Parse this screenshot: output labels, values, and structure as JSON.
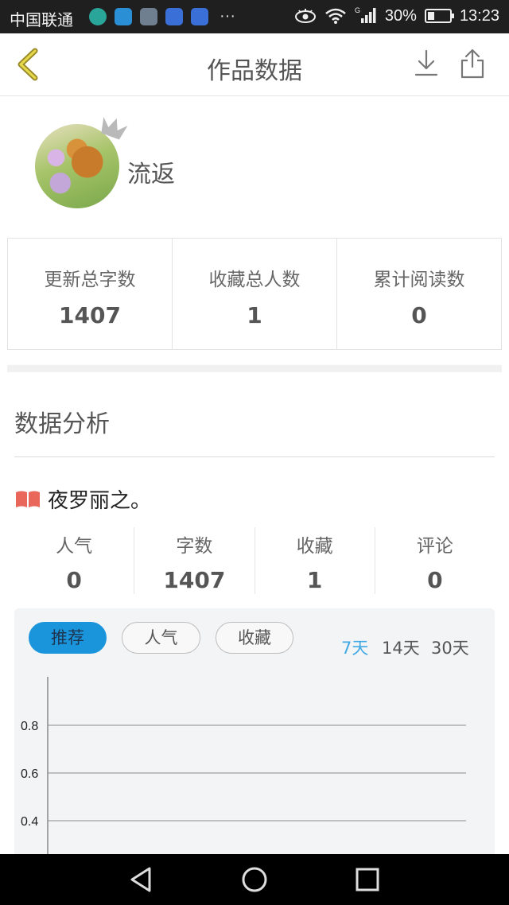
{
  "status_bar": {
    "carrier": "中国联通",
    "battery": "30%",
    "time": "13:23",
    "network_badge": "G",
    "more_indicator": "···",
    "battery_level": 0.3
  },
  "nav": {
    "title": "作品数据",
    "icons": [
      "chevron-left-icon",
      "download-icon",
      "share-icon"
    ]
  },
  "profile": {
    "username": "流返"
  },
  "stats": [
    {
      "label": "更新总字数",
      "value": "1407"
    },
    {
      "label": "收藏总人数",
      "value": "1"
    },
    {
      "label": "累计阅读数",
      "value": "0"
    }
  ],
  "analysis": {
    "title": "数据分析",
    "book_title": "夜罗丽之。",
    "metrics": [
      {
        "label": "人气",
        "value": "0"
      },
      {
        "label": "字数",
        "value": "1407"
      },
      {
        "label": "收藏",
        "value": "1"
      },
      {
        "label": "评论",
        "value": "0"
      }
    ]
  },
  "chart_tabs": [
    "推荐",
    "人气",
    "收藏"
  ],
  "chart_tab_active": 0,
  "chart_ranges": [
    "7天",
    "14天",
    "30天"
  ],
  "chart_range_active": 0,
  "colors": {
    "accent": "#1a95dc",
    "range_active": "#41a9e3",
    "book_icon": "#e8675a"
  },
  "chart_data": {
    "type": "line",
    "y_ticks": [
      "0.8",
      "0.6",
      "0.4"
    ],
    "ylim": [
      0.2,
      1.0
    ],
    "grid": true,
    "series": []
  }
}
